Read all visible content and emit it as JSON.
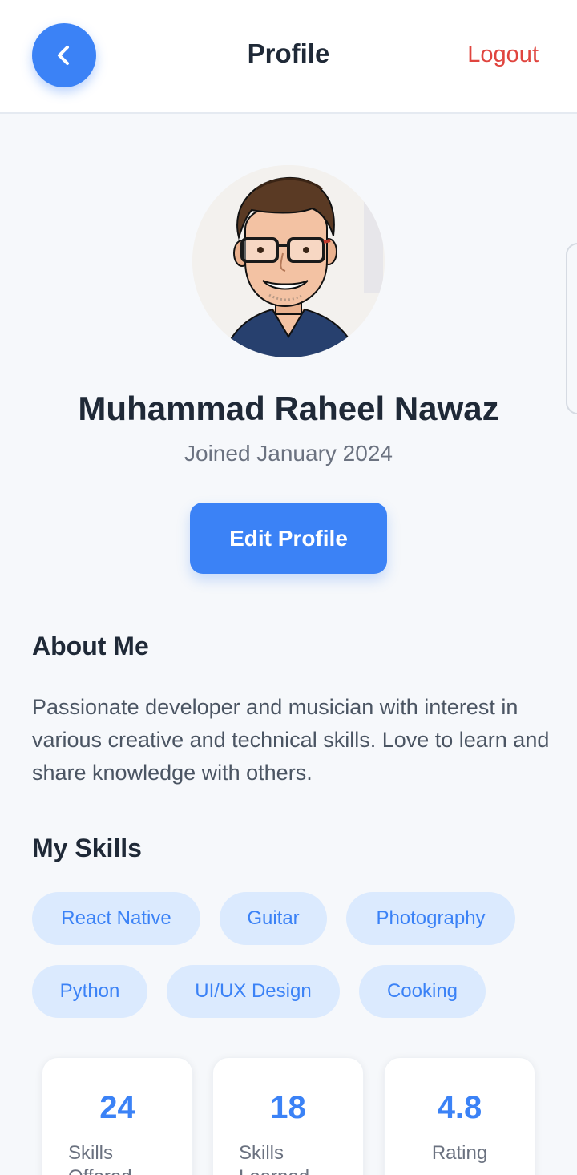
{
  "header": {
    "title": "Profile",
    "logout_label": "Logout",
    "back_icon": "chevron-left-icon"
  },
  "profile": {
    "name": "Muhammad Raheel Nawaz",
    "joined": "Joined January 2024",
    "edit_label": "Edit Profile",
    "avatar_icon": "cartoon-avatar"
  },
  "about": {
    "title": "About Me",
    "text": "Passionate developer and musician with interest in various creative and technical skills. Love to learn and share knowledge with others."
  },
  "skills": {
    "title": "My Skills",
    "items": [
      "React Native",
      "Guitar",
      "Photography",
      "Python",
      "UI/UX Design",
      "Cooking"
    ]
  },
  "stats": [
    {
      "value": "24",
      "label": "Skills Offered"
    },
    {
      "value": "18",
      "label": "Skills Learned"
    },
    {
      "value": "4.8",
      "label": "Rating"
    }
  ],
  "colors": {
    "accent": "#3b82f6",
    "logout": "#e0453f",
    "chip_bg": "#dbeafe",
    "background": "#f6f8fb"
  }
}
